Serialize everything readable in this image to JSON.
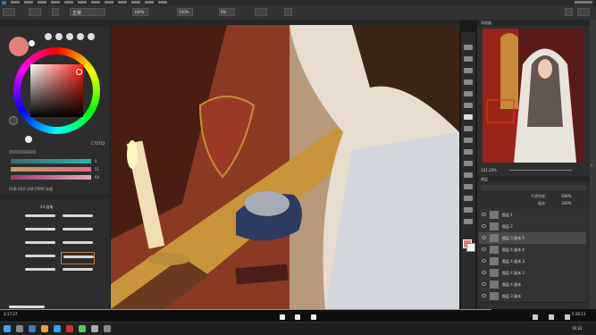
{
  "options": {
    "mode_value": "正常",
    "opacity_value": "100%",
    "flow_value": "100%",
    "smooth_value": "0%"
  },
  "color": {
    "primary": "#e37f7a",
    "hex_value": "C75752"
  },
  "sliders": [
    {
      "value": "0"
    },
    {
      "value": "51"
    },
    {
      "value": "64"
    }
  ],
  "modes": "RGB HSV LAB CMYK 灰度",
  "brush_tabs": {
    "folder": "43 画笔"
  },
  "layers": [
    {
      "name": "图层 1"
    },
    {
      "name": "图层 2"
    },
    {
      "name": "图层 3 副本 5",
      "selected": true
    },
    {
      "name": "图层 4 副本 4"
    },
    {
      "name": "图层 4 副本 3"
    },
    {
      "name": "图层 4 副本 2"
    },
    {
      "name": "图层 4 副本"
    },
    {
      "name": "图层 3 副本"
    },
    {
      "name": "图层 2 副本"
    }
  ],
  "navigator": {
    "zoom": "131.28%",
    "title": "导航器"
  },
  "layers_panel": {
    "title": "图层",
    "opacity_label": "不透明度:",
    "opacity": "100%",
    "fill_label": "填充:",
    "fill": "100%"
  },
  "playback": {
    "elapsed": "3:17:27",
    "total": "5:26:11"
  },
  "taskbar": {
    "time": "16:22"
  },
  "icons": [
    "brush-icon",
    "eraser-icon",
    "move-icon",
    "lasso-icon",
    "crop-icon",
    "eyedropper-icon",
    "heal-icon",
    "stamp-icon",
    "gradient-icon",
    "dodge-icon",
    "pen-icon",
    "text-icon",
    "path-icon",
    "shape-icon",
    "hand-icon",
    "zoom-icon"
  ]
}
